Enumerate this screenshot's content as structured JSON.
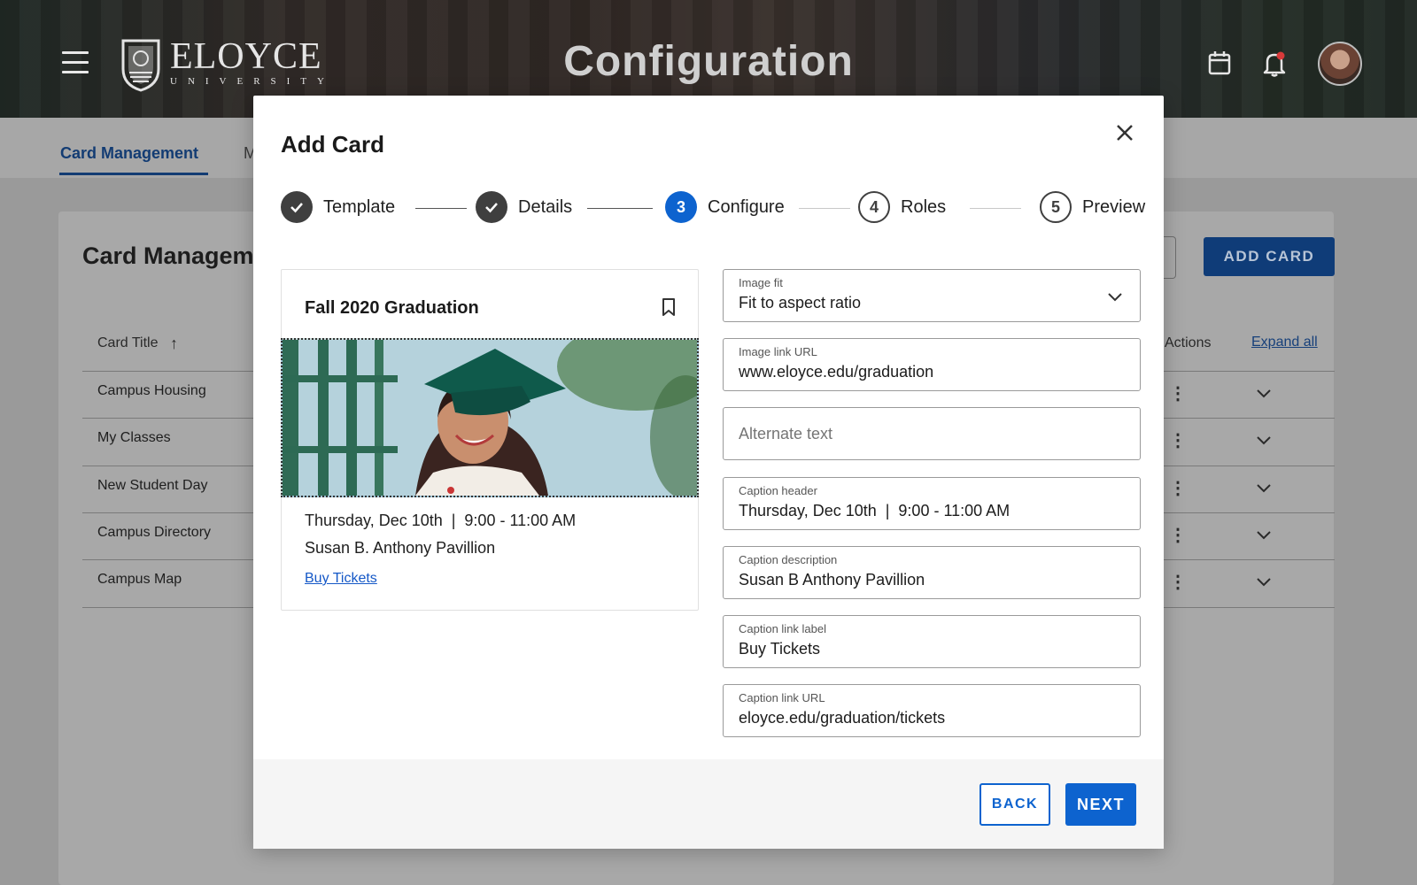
{
  "header": {
    "title": "Configuration",
    "logo_name": "ELOYCE",
    "logo_sub": "UNIVERSITY",
    "icons": [
      "menu-icon",
      "calendar-icon",
      "bell-icon",
      "avatar"
    ]
  },
  "page": {
    "tabs": [
      {
        "label": "Card Management",
        "active": true
      },
      {
        "label": "M",
        "active": false
      }
    ],
    "section_title": "Card Management",
    "add_card_label": "ADD CARD",
    "table": {
      "columns": [
        "Card Title",
        "Actions"
      ],
      "expand_all_label": "Expand all",
      "rows": [
        "Campus Housing",
        "My Classes",
        "New Student Day",
        "Campus Directory",
        "Campus Map"
      ]
    }
  },
  "modal": {
    "title": "Add Card",
    "steps": [
      {
        "number": "1",
        "label": "Template",
        "state": "done"
      },
      {
        "number": "2",
        "label": "Details",
        "state": "done"
      },
      {
        "number": "3",
        "label": "Configure",
        "state": "current"
      },
      {
        "number": "4",
        "label": "Roles",
        "state": "future"
      },
      {
        "number": "5",
        "label": "Preview",
        "state": "future"
      }
    ],
    "preview": {
      "title": "Fall 2020 Graduation",
      "caption_header": "Thursday, Dec 10th  |  9:00 - 11:00 AM",
      "caption_description": "Susan B. Anthony Pavillion",
      "link_label": "Buy Tickets"
    },
    "form": {
      "image_fit": {
        "label": "Image fit",
        "value": "Fit to aspect ratio"
      },
      "image_link_url": {
        "label": "Image link URL",
        "value": "www.eloyce.edu/graduation"
      },
      "alternate_text": {
        "placeholder": "Alternate text"
      },
      "caption_header": {
        "label": "Caption header",
        "value": "Thursday, Dec 10th  |  9:00 - 11:00 AM"
      },
      "caption_description": {
        "label": "Caption description",
        "value": "Susan B Anthony Pavillion"
      },
      "caption_link_label": {
        "label": "Caption link label",
        "value": "Buy Tickets"
      },
      "caption_link_url": {
        "label": "Caption link URL",
        "value": "eloyce.edu/graduation/tickets"
      }
    },
    "buttons": {
      "back": "BACK",
      "next": "NEXT"
    }
  },
  "colors": {
    "primary": "#0d63cf",
    "navy": "#0f3c78",
    "link": "#1558c7"
  }
}
